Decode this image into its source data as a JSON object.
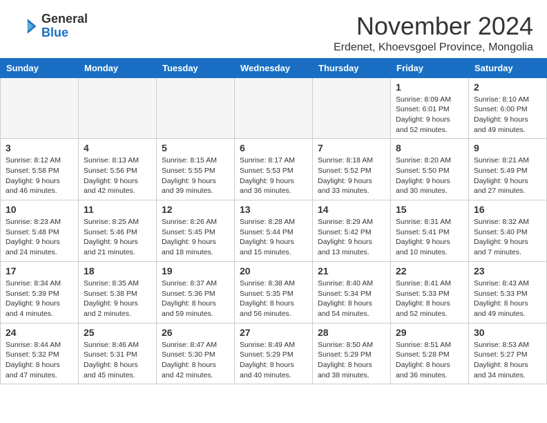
{
  "header": {
    "logo_general": "General",
    "logo_blue": "Blue",
    "month_title": "November 2024",
    "location": "Erdenet, Khoevsgoel Province, Mongolia"
  },
  "weekdays": [
    "Sunday",
    "Monday",
    "Tuesday",
    "Wednesday",
    "Thursday",
    "Friday",
    "Saturday"
  ],
  "weeks": [
    [
      {
        "day": "",
        "info": ""
      },
      {
        "day": "",
        "info": ""
      },
      {
        "day": "",
        "info": ""
      },
      {
        "day": "",
        "info": ""
      },
      {
        "day": "",
        "info": ""
      },
      {
        "day": "1",
        "info": "Sunrise: 8:09 AM\nSunset: 6:01 PM\nDaylight: 9 hours and 52 minutes."
      },
      {
        "day": "2",
        "info": "Sunrise: 8:10 AM\nSunset: 6:00 PM\nDaylight: 9 hours and 49 minutes."
      }
    ],
    [
      {
        "day": "3",
        "info": "Sunrise: 8:12 AM\nSunset: 5:58 PM\nDaylight: 9 hours and 46 minutes."
      },
      {
        "day": "4",
        "info": "Sunrise: 8:13 AM\nSunset: 5:56 PM\nDaylight: 9 hours and 42 minutes."
      },
      {
        "day": "5",
        "info": "Sunrise: 8:15 AM\nSunset: 5:55 PM\nDaylight: 9 hours and 39 minutes."
      },
      {
        "day": "6",
        "info": "Sunrise: 8:17 AM\nSunset: 5:53 PM\nDaylight: 9 hours and 36 minutes."
      },
      {
        "day": "7",
        "info": "Sunrise: 8:18 AM\nSunset: 5:52 PM\nDaylight: 9 hours and 33 minutes."
      },
      {
        "day": "8",
        "info": "Sunrise: 8:20 AM\nSunset: 5:50 PM\nDaylight: 9 hours and 30 minutes."
      },
      {
        "day": "9",
        "info": "Sunrise: 8:21 AM\nSunset: 5:49 PM\nDaylight: 9 hours and 27 minutes."
      }
    ],
    [
      {
        "day": "10",
        "info": "Sunrise: 8:23 AM\nSunset: 5:48 PM\nDaylight: 9 hours and 24 minutes."
      },
      {
        "day": "11",
        "info": "Sunrise: 8:25 AM\nSunset: 5:46 PM\nDaylight: 9 hours and 21 minutes."
      },
      {
        "day": "12",
        "info": "Sunrise: 8:26 AM\nSunset: 5:45 PM\nDaylight: 9 hours and 18 minutes."
      },
      {
        "day": "13",
        "info": "Sunrise: 8:28 AM\nSunset: 5:44 PM\nDaylight: 9 hours and 15 minutes."
      },
      {
        "day": "14",
        "info": "Sunrise: 8:29 AM\nSunset: 5:42 PM\nDaylight: 9 hours and 13 minutes."
      },
      {
        "day": "15",
        "info": "Sunrise: 8:31 AM\nSunset: 5:41 PM\nDaylight: 9 hours and 10 minutes."
      },
      {
        "day": "16",
        "info": "Sunrise: 8:32 AM\nSunset: 5:40 PM\nDaylight: 9 hours and 7 minutes."
      }
    ],
    [
      {
        "day": "17",
        "info": "Sunrise: 8:34 AM\nSunset: 5:39 PM\nDaylight: 9 hours and 4 minutes."
      },
      {
        "day": "18",
        "info": "Sunrise: 8:35 AM\nSunset: 5:38 PM\nDaylight: 9 hours and 2 minutes."
      },
      {
        "day": "19",
        "info": "Sunrise: 8:37 AM\nSunset: 5:36 PM\nDaylight: 8 hours and 59 minutes."
      },
      {
        "day": "20",
        "info": "Sunrise: 8:38 AM\nSunset: 5:35 PM\nDaylight: 8 hours and 56 minutes."
      },
      {
        "day": "21",
        "info": "Sunrise: 8:40 AM\nSunset: 5:34 PM\nDaylight: 8 hours and 54 minutes."
      },
      {
        "day": "22",
        "info": "Sunrise: 8:41 AM\nSunset: 5:33 PM\nDaylight: 8 hours and 52 minutes."
      },
      {
        "day": "23",
        "info": "Sunrise: 8:43 AM\nSunset: 5:33 PM\nDaylight: 8 hours and 49 minutes."
      }
    ],
    [
      {
        "day": "24",
        "info": "Sunrise: 8:44 AM\nSunset: 5:32 PM\nDaylight: 8 hours and 47 minutes."
      },
      {
        "day": "25",
        "info": "Sunrise: 8:46 AM\nSunset: 5:31 PM\nDaylight: 8 hours and 45 minutes."
      },
      {
        "day": "26",
        "info": "Sunrise: 8:47 AM\nSunset: 5:30 PM\nDaylight: 8 hours and 42 minutes."
      },
      {
        "day": "27",
        "info": "Sunrise: 8:49 AM\nSunset: 5:29 PM\nDaylight: 8 hours and 40 minutes."
      },
      {
        "day": "28",
        "info": "Sunrise: 8:50 AM\nSunset: 5:29 PM\nDaylight: 8 hours and 38 minutes."
      },
      {
        "day": "29",
        "info": "Sunrise: 8:51 AM\nSunset: 5:28 PM\nDaylight: 8 hours and 36 minutes."
      },
      {
        "day": "30",
        "info": "Sunrise: 8:53 AM\nSunset: 5:27 PM\nDaylight: 8 hours and 34 minutes."
      }
    ]
  ]
}
